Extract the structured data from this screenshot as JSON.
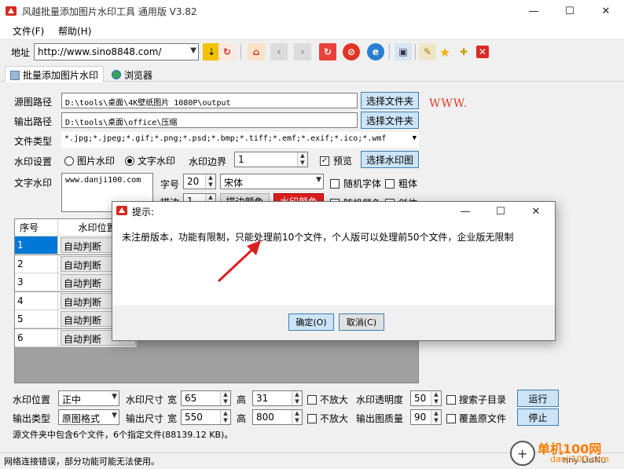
{
  "window": {
    "title": "风越批量添加图片水印工具 通用版 V3.82",
    "controls": [
      "—",
      "☐",
      "✕"
    ]
  },
  "menu": [
    "文件(F)",
    "帮助(H)"
  ],
  "toolbar": {
    "address_label": "地址",
    "address_value": "http://www.sino8848.com/"
  },
  "tabs": [
    {
      "label": "批量添加图片水印"
    },
    {
      "label": "浏览器"
    }
  ],
  "form": {
    "source_label": "源图路径",
    "source_value": "D:\\tools\\桌面\\4K壁纸图片 1080P\\output",
    "source_btn": "选择文件夹",
    "output_label": "输出路径",
    "output_value": "D:\\tools\\桌面\\office\\压缩",
    "output_btn": "选择文件夹",
    "www_text": "WWW.",
    "filetype_label": "文件类型",
    "filetype_value": "*.jpg;*.jpeg;*.gif;*.png;*.psd;*.bmp;*.tiff;*.emf;*.exif;*.ico;*.wmf",
    "wm_setting_label": "水印设置",
    "image_wm": "图片水印",
    "text_wm": "文字水印",
    "wm_border_label": "水印边界",
    "wm_border_value": "1",
    "preview_label": "预览",
    "choose_wm_btn": "选择水印图",
    "text_wm_label": "文字水印",
    "text_wm_value": "www.danji100.com",
    "fontsize_label": "字号",
    "fontsize_value": "20",
    "font_value": "宋体",
    "random_font": "随机字体",
    "bold": "粗体",
    "row3_label": "描边",
    "row3_value": "1",
    "row3_btn1": "描边颜色",
    "row3_btn2": "水印颜色",
    "random_color": "随机颜色",
    "italic": "斜体"
  },
  "grid": {
    "headers": [
      "序号",
      "水印位置"
    ],
    "rows": [
      {
        "no": "1",
        "pos": "自动判断"
      },
      {
        "no": "2",
        "pos": "自动判断"
      },
      {
        "no": "3",
        "pos": "自动判断"
      },
      {
        "no": "4",
        "pos": "自动判断"
      },
      {
        "no": "5",
        "pos": "自动判断"
      },
      {
        "no": "6",
        "pos": "自动判断"
      }
    ]
  },
  "dialog": {
    "title": "提示:",
    "message": "未注册版本，功能有限制，只能处理前10个文件，个人版可以处理前50个文件，企业版无限制",
    "ok": "确定(O)",
    "cancel": "取消(C)"
  },
  "bottom": {
    "pos_label": "水印位置",
    "pos_value": "正中",
    "wm_size_label": "水印尺寸",
    "width_label": "宽",
    "wm_width": "65",
    "height_label": "高",
    "wm_height": "31",
    "no_enlarge": "不放大",
    "opacity_label": "水印透明度",
    "opacity_value": "50",
    "search_sub": "搜索子目录",
    "run_btn": "运行",
    "outtype_label": "输出类型",
    "outtype_value": "原图格式",
    "out_size_label": "输出尺寸",
    "out_width": "550",
    "out_height": "800",
    "quality_label": "输出图质量",
    "quality_value": "90",
    "overwrite": "覆盖原文件",
    "stop_btn": "停止",
    "info": "源文件夹中包含6个文件，6个指定文件(88139.12 KB)。"
  },
  "status": {
    "text": "网络连接错误，部分功能可能无法使用。",
    "right_text": "nny LiuNu",
    "watermark_logo": "单机100网",
    "watermark_url": "danji100.com"
  },
  "colors": {
    "accent_btn": "#cce4f7",
    "red_btn": "#e02020",
    "selection": "#0078d7",
    "arrow": "#d92020"
  }
}
